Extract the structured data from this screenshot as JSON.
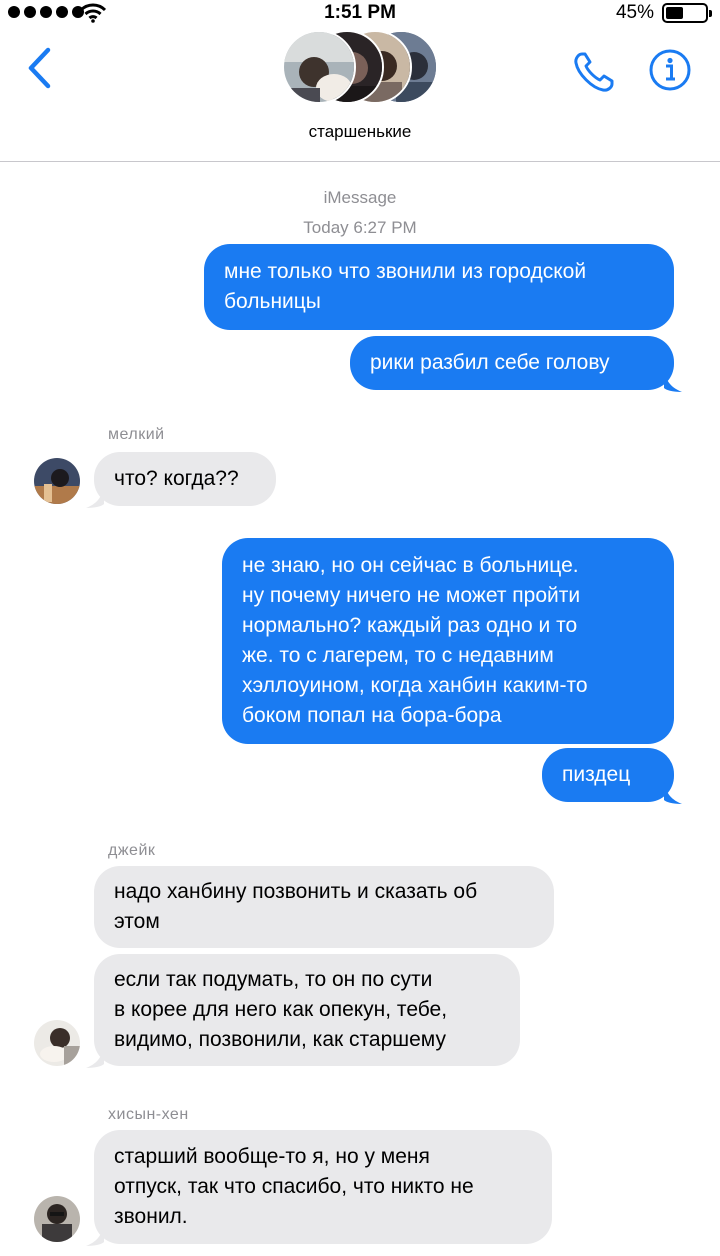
{
  "status": {
    "time": "1:51 PM",
    "battery": "45%"
  },
  "header": {
    "group_name": "старшенькие"
  },
  "thread": {
    "service": "iMessage",
    "timestamp": "Today 6:27 PM"
  },
  "messages": [
    {
      "text": "мне только что звонили из городской\nбольницы"
    },
    {
      "text": "рики разбил себе голову"
    },
    {
      "sender": "мелкий",
      "text": "что? когда??"
    },
    {
      "text": "не знаю, но он сейчас в больнице.\nну почему ничего не может пройти\nнормально? каждый раз одно и то\nже. то с лагерем, то с недавним\nхэллоуином, когда ханбин каким-то\nбоком попал на бора-бора"
    },
    {
      "text": "пиздец"
    },
    {
      "sender": "джейк",
      "text": "надо ханбину позвонить и сказать об\nэтом"
    },
    {
      "text": "если так подумать, то он по сути\nв корее для него как опекун, тебе,\nвидимо, позвонили, как старшему"
    },
    {
      "sender": "хисын-хен",
      "text": "старший вообще-то я, но у меня\nотпуск, так что спасибо, что никто не\nзвонил."
    }
  ],
  "colors": {
    "accent": "#1a7bf2",
    "incoming_bubble": "#e9e9eb",
    "meta_text": "#8e8e93"
  }
}
